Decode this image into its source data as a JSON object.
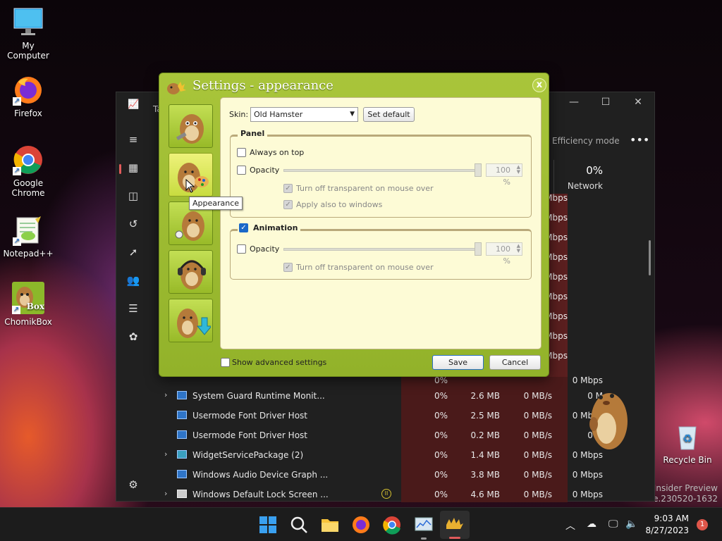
{
  "desktop": {
    "icons": [
      {
        "label": "My Computer",
        "icon": "monitor-icon"
      },
      {
        "label": "Firefox",
        "icon": "firefox-icon"
      },
      {
        "label": "Google\nChrome",
        "icon": "chrome-icon"
      },
      {
        "label": "Notepad++",
        "icon": "notepadpp-icon"
      },
      {
        "label": "ChomikBox",
        "icon": "chomikbox-icon"
      }
    ],
    "recycle_bin": "Recycle Bin",
    "watermark_line1": "ro Insider Preview",
    "watermark_line2": "ease.230520-1632",
    "chomikbox_overlay": "Box"
  },
  "taskmgr": {
    "title": "Ta",
    "efficiency_mode": "Efficiency mode",
    "network_pct": "0%",
    "network_label": "Network",
    "net_cells_top": [
      "0 Mbps",
      "0 Mbps",
      "0 Mbps",
      "0 Mbps",
      "0 Mbps",
      "0 Mbps",
      "0 Mbps",
      "0 Mbps",
      "0 Mbps"
    ],
    "partial_row": {
      "c1": "0%",
      "c4": "0 Mbps"
    },
    "rows": [
      {
        "expand": "›",
        "name": "System Guard Runtime Monit...",
        "cpu": "0%",
        "mem": "2.6 MB",
        "disk": "0 MB/s",
        "net": "0 M"
      },
      {
        "expand": "",
        "name": "Usermode Font Driver Host",
        "cpu": "0%",
        "mem": "2.5 MB",
        "disk": "0 MB/s",
        "net": "0 Mbps"
      },
      {
        "expand": "",
        "name": "Usermode Font Driver Host",
        "cpu": "0%",
        "mem": "0.2 MB",
        "disk": "0 MB/s",
        "net": "0 M"
      },
      {
        "expand": "›",
        "name": "WidgetServicePackage (2)",
        "cpu": "0%",
        "mem": "1.4 MB",
        "disk": "0 MB/s",
        "net": "0 Mbps"
      },
      {
        "expand": "",
        "name": "Windows Audio Device Graph ...",
        "cpu": "0%",
        "mem": "3.8 MB",
        "disk": "0 MB/s",
        "net": "0 Mbps"
      },
      {
        "expand": "›",
        "name": "Windows Default Lock Screen ...",
        "cpu": "0%",
        "mem": "4.6 MB",
        "disk": "0 MB/s",
        "net": "0 Mbps"
      }
    ]
  },
  "dialog": {
    "title": "Settings - appearance",
    "close": "x",
    "tooltip": "Appearance",
    "skin_label": "Skin:",
    "skin_value": "Old Hamster",
    "set_default": "Set default",
    "panel": {
      "title": "Panel",
      "always_on_top": "Always on top",
      "opacity": "Opacity",
      "opacity_value": "100 %",
      "opacity_level": 1.0,
      "turn_off_transparent": "Turn off transparent on mouse over",
      "apply_windows": "Apply also to windows"
    },
    "animation": {
      "title": "Animation",
      "opacity": "Opacity",
      "opacity_value": "100 %",
      "opacity_level": 1.0,
      "turn_off_transparent": "Turn off transparent on mouse over"
    },
    "show_advanced": "Show advanced settings",
    "save": "Save",
    "cancel": "Cancel"
  },
  "taskbar": {
    "time": "9:03 AM",
    "date": "8/27/2023",
    "badge": "1"
  },
  "colors": {
    "dialog_green": "#a9c53a",
    "panel_cream": "#fdfbd6",
    "check_blue": "#1a68c8"
  }
}
